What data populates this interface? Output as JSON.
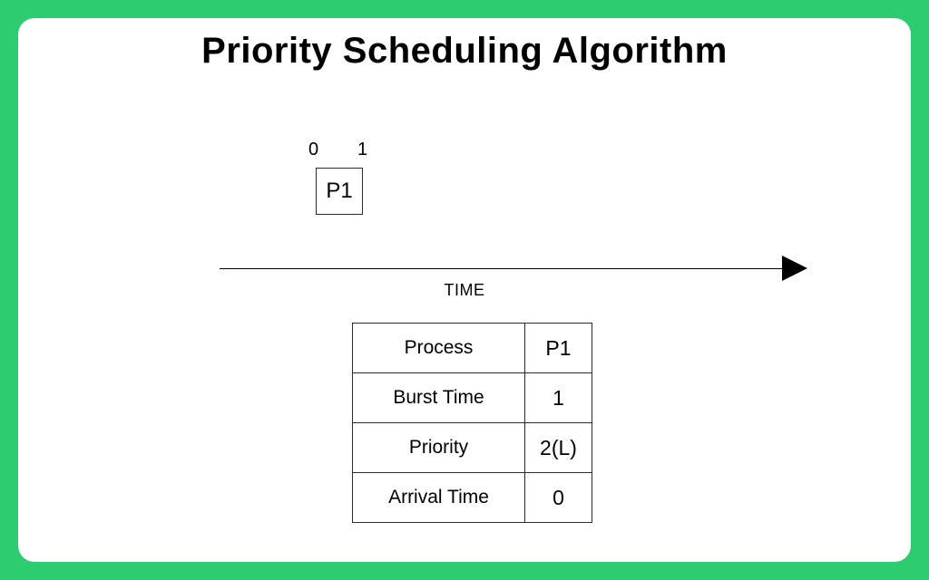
{
  "title": "Priority Scheduling Algorithm",
  "gantt": {
    "ticks": {
      "start": "0",
      "end": "1"
    },
    "block_label": "P1"
  },
  "axis": {
    "label": "TIME"
  },
  "table": {
    "rows": [
      {
        "label": "Process",
        "value": "P1"
      },
      {
        "label": "Burst Time",
        "value": "1"
      },
      {
        "label": "Priority",
        "value": "2(L)"
      },
      {
        "label": "Arrival Time",
        "value": "0"
      }
    ]
  },
  "chart_data": {
    "type": "table",
    "title": "Priority Scheduling Algorithm",
    "processes": [
      {
        "name": "P1",
        "burst_time": 1,
        "priority": "2(L)",
        "arrival_time": 0
      }
    ],
    "gantt": [
      {
        "process": "P1",
        "start": 0,
        "end": 1
      }
    ],
    "xlabel": "TIME"
  }
}
